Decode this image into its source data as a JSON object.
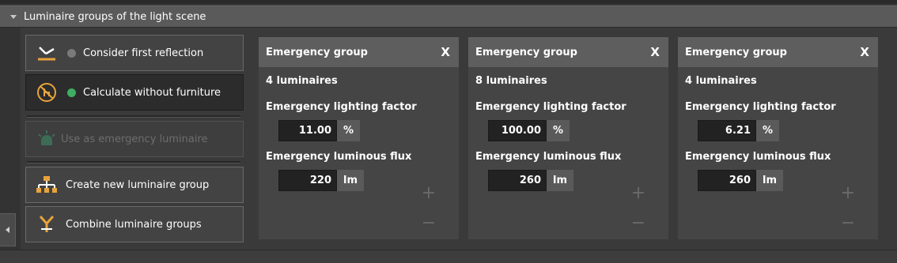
{
  "section": {
    "title": "Luminaire groups of the light scene"
  },
  "actions": {
    "consider_reflection": {
      "label": "Consider first reflection",
      "status_color": "#7a7a7a"
    },
    "calc_without_furniture": {
      "label": "Calculate without furniture",
      "status_color": "#3fae62"
    },
    "use_as_emergency": {
      "label": "Use as emergency luminaire"
    },
    "create_group": {
      "label": "Create new luminaire group"
    },
    "combine_groups": {
      "label": "Combine luminaire groups"
    }
  },
  "groups": [
    {
      "name": "Emergency group",
      "close": "X",
      "count": "4 luminaires",
      "factor_label": "Emergency lighting factor",
      "factor_value": "11.00",
      "factor_unit": "%",
      "flux_label": "Emergency luminous flux",
      "flux_value": "220",
      "flux_unit": "lm",
      "add": "+",
      "remove": "−"
    },
    {
      "name": "Emergency group",
      "close": "X",
      "count": "8 luminaires",
      "factor_label": "Emergency lighting factor",
      "factor_value": "100.00",
      "factor_unit": "%",
      "flux_label": "Emergency luminous flux",
      "flux_value": "260",
      "flux_unit": "lm",
      "add": "+",
      "remove": "−"
    },
    {
      "name": "Emergency group",
      "close": "X",
      "count": "4 luminaires",
      "factor_label": "Emergency lighting factor",
      "factor_value": "6.21",
      "factor_unit": "%",
      "flux_label": "Emergency luminous flux",
      "flux_value": "260",
      "flux_unit": "lm",
      "add": "+",
      "remove": "−"
    }
  ],
  "colors": {
    "accent_orange": "#e8a33c",
    "panel_bg": "#3a3a3a",
    "card_bg": "#454545",
    "card_header": "#5e5e5e"
  }
}
